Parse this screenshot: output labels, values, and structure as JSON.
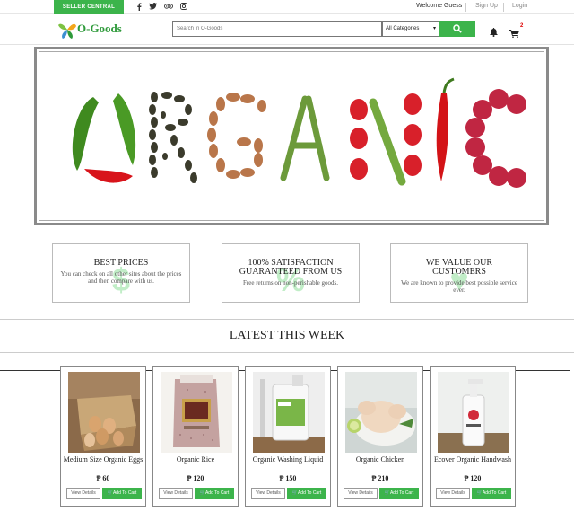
{
  "topbar": {
    "seller_label": "SELLER CENTRAL",
    "socials": [
      "f",
      "t",
      "ig",
      "p"
    ],
    "welcome": "Welcome Guess",
    "signup": "Sign Up",
    "login": "Login"
  },
  "header": {
    "logo_text": "O-Goods",
    "search_placeholder": "Search in O-Goods",
    "category_selected": "All Categories",
    "cart_count": "2"
  },
  "banner": {
    "word": "ORGANIC"
  },
  "features": [
    {
      "title": "BEST PRICES",
      "text": "You can check on all other sites about the prices and then compare with us.",
      "icon": "$"
    },
    {
      "title": "100% SATISFACTION GUARANTEED FROM US",
      "text": "Free returns on non-perishable goods.",
      "icon": "%"
    },
    {
      "title": "WE VALUE OUR CUSTOMERS",
      "text": "We are known to provide best possible service ever.",
      "icon": "♥"
    }
  ],
  "latest": {
    "title": "LATEST THIS WEEK"
  },
  "products": [
    {
      "name": "Medium Size Organic Eggs",
      "price": "₱ 60",
      "view": "View Details",
      "add": "Add To Cart"
    },
    {
      "name": "Organic Rice",
      "price": "₱ 120",
      "view": "View Details",
      "add": "Add To Cart"
    },
    {
      "name": "Organic Washing Liquid",
      "price": "₱ 150",
      "view": "View Details",
      "add": "Add To Cart"
    },
    {
      "name": "Organic Chicken",
      "price": "₱ 210",
      "view": "View Details",
      "add": "Add To Cart"
    },
    {
      "name": "Ecover Organic Handwash",
      "price": "₱ 120",
      "view": "View Details",
      "add": "Add To Cart"
    }
  ],
  "colors": {
    "accent": "#3cb44b",
    "cart_badge": "#dd0000"
  }
}
